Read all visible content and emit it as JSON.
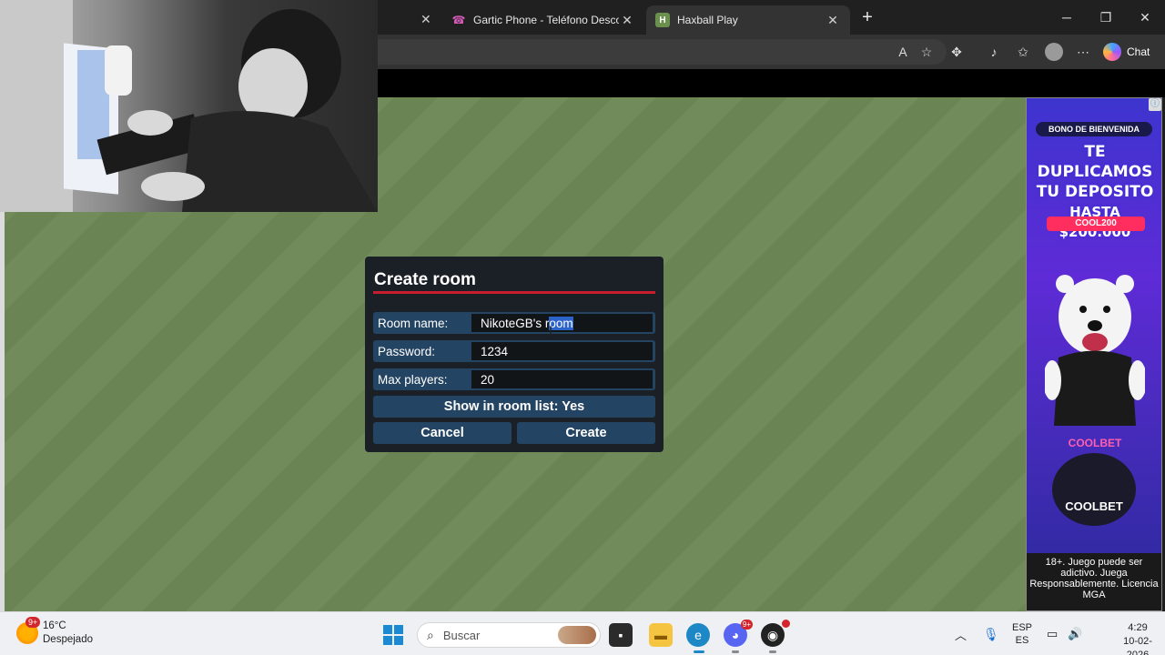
{
  "browser": {
    "tabs": [
      {
        "title": "Gartic Phone - Teléfono Descompuesto",
        "favicon": "gartic-phone-icon",
        "active": false
      },
      {
        "title": "Haxball Play",
        "favicon": "haxball-icon",
        "favicon_letter": "H",
        "active": true
      }
    ],
    "new_tab_glyph": "+",
    "toolbar": {
      "chat_label": "Chat"
    }
  },
  "dialog": {
    "title": "Create room",
    "fields": [
      {
        "label": "Room name:",
        "value_plain": "NikoteGB's r",
        "value_selected": "oom"
      },
      {
        "label": "Password:",
        "value": "1234"
      },
      {
        "label": "Max players:",
        "value": "20"
      }
    ],
    "toggle_label": "Show in room list: Yes",
    "cancel_label": "Cancel",
    "create_label": "Create",
    "accent_color": "#c91d2f"
  },
  "ad": {
    "badge": "BONO DE BIENVENIDA",
    "headline_1": "TE DUPLICAMOS",
    "headline_2": "TU DEPOSITO",
    "headline_3": "HASTA $200.000",
    "code": "COOL200",
    "brand_small": "COOLBET",
    "brand": "COOLBET",
    "legal": "18+. Juego puede ser adictivo. Juega Responsablemente. Licencia MGA"
  },
  "taskbar": {
    "weather_badge": "9+",
    "temperature": "16°C",
    "condition": "Despejado",
    "search_label": "Buscar",
    "discord_badge": "9+",
    "lang_1": "ESP",
    "lang_2": "ES",
    "time": "4:29",
    "date": "10-02-2026"
  }
}
